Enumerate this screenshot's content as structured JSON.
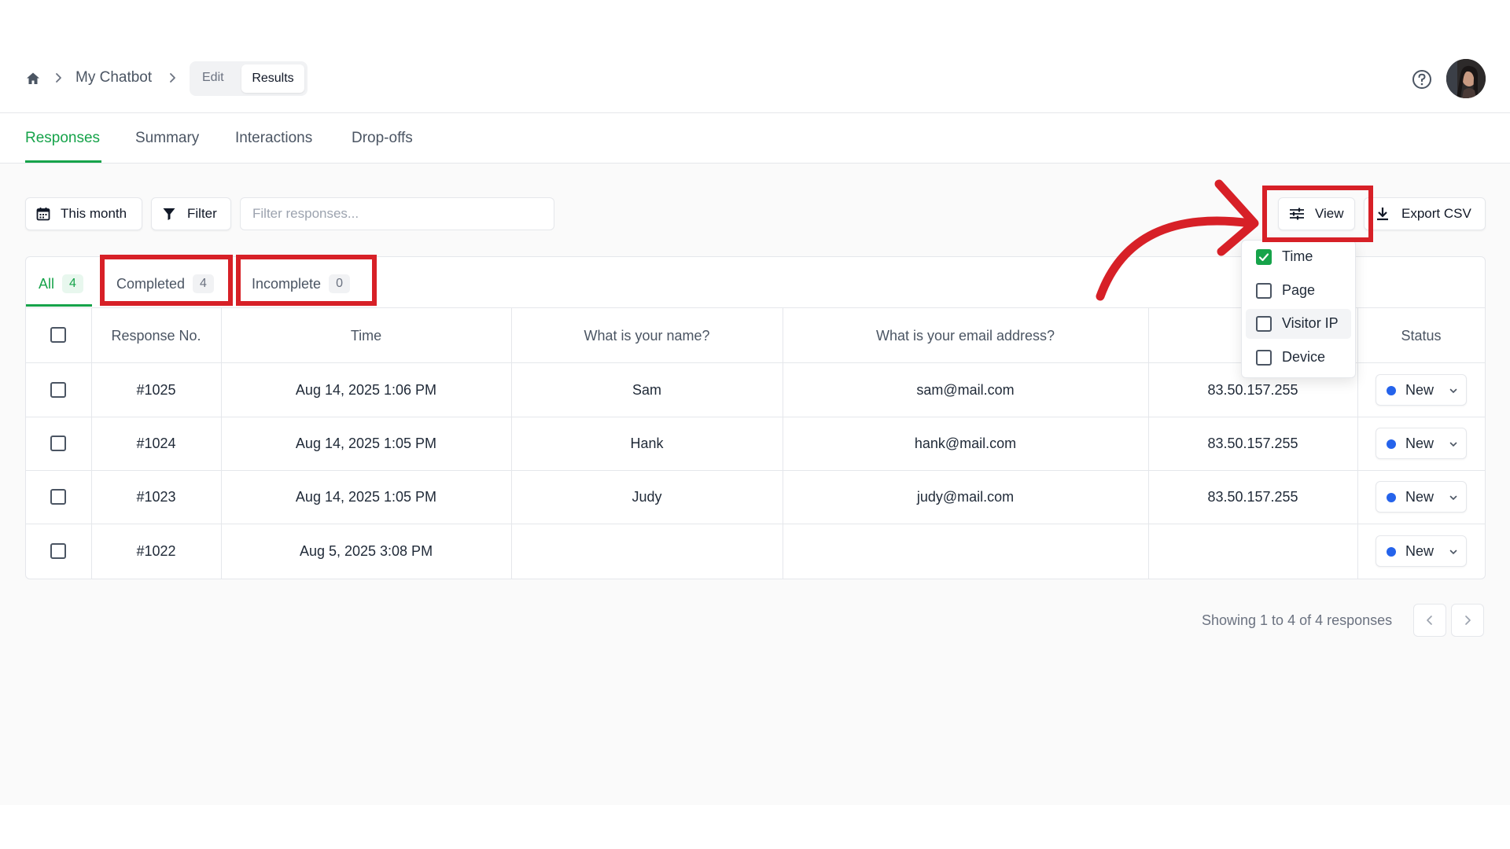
{
  "breadcrumb": {
    "home_icon": "home-icon",
    "separator_icon": "chevron-right-icon",
    "title": "My Chatbot",
    "modes": [
      "Edit",
      "Results"
    ],
    "active_mode": "Results"
  },
  "header_right": {
    "help_icon": "question-circle-icon",
    "avatar_icon": "user-avatar"
  },
  "tabs": [
    {
      "label": "Responses",
      "active": true
    },
    {
      "label": "Summary",
      "active": false
    },
    {
      "label": "Interactions",
      "active": false
    },
    {
      "label": "Drop-offs",
      "active": false
    }
  ],
  "toolbar": {
    "date_range_label": "This month",
    "date_icon": "calendar-icon",
    "filter_label": "Filter",
    "filter_icon": "funnel-icon",
    "search_placeholder": "Filter responses...",
    "view_label": "View",
    "view_icon": "sliders-icon",
    "export_label": "Export CSV",
    "export_icon": "download-icon"
  },
  "filter_tabs": [
    {
      "label": "All",
      "count": "4",
      "active": true
    },
    {
      "label": "Completed",
      "count": "4",
      "active": false
    },
    {
      "label": "Incomplete",
      "count": "0",
      "active": false
    }
  ],
  "columns": [
    "Response No.",
    "Time",
    "What is your name?",
    "What is your email address?",
    "Status"
  ],
  "rows": [
    {
      "id": "#1025",
      "time": "Aug 14, 2025 1:06 PM",
      "name": "Sam",
      "email": "sam@mail.com",
      "ip": "83.50.157.255",
      "status": "New"
    },
    {
      "id": "#1024",
      "time": "Aug 14, 2025 1:05 PM",
      "name": "Hank",
      "email": "hank@mail.com",
      "ip": "83.50.157.255",
      "status": "New"
    },
    {
      "id": "#1023",
      "time": "Aug 14, 2025 1:05 PM",
      "name": "Judy",
      "email": "judy@mail.com",
      "ip": "83.50.157.255",
      "status": "New"
    },
    {
      "id": "#1022",
      "time": "Aug 5, 2025 3:08 PM",
      "name": "",
      "email": "",
      "ip": "",
      "status": "New"
    }
  ],
  "view_menu": {
    "items": [
      {
        "label": "Time",
        "checked": true
      },
      {
        "label": "Page",
        "checked": false
      },
      {
        "label": "Visitor IP",
        "checked": false
      },
      {
        "label": "Device",
        "checked": false
      }
    ]
  },
  "pagination": {
    "summary": "Showing 1 to 4 of 4 responses",
    "prev_icon": "chevron-left-icon",
    "next_icon": "chevron-right-icon"
  },
  "colors": {
    "accent_green": "#16a34a",
    "status_dot_blue": "#2563eb",
    "annotation_red": "#d72027"
  }
}
